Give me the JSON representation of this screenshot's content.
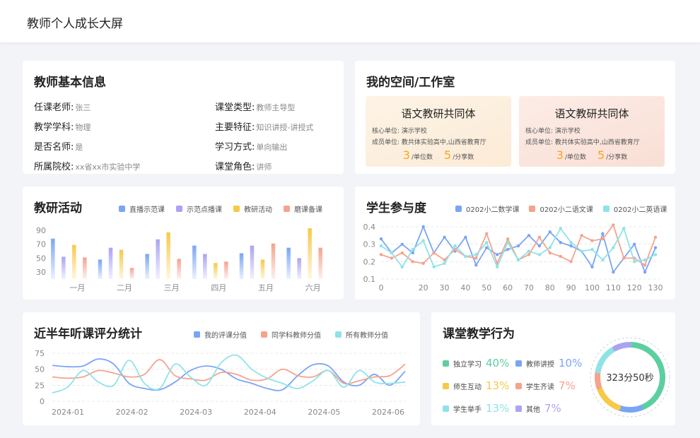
{
  "header": {
    "title": "教师个人成长大屏"
  },
  "teacher_info": {
    "title": "教师基本信息",
    "left": [
      {
        "label": "任课老师:",
        "value": "张三"
      },
      {
        "label": "教学学科:",
        "value": "物理"
      },
      {
        "label": "是否名师:",
        "value": "是"
      },
      {
        "label": "所属院校:",
        "value": "xx省xx市实验中学"
      }
    ],
    "right": [
      {
        "label": "课堂类型:",
        "value": "教师主导型"
      },
      {
        "label": "主要特征:",
        "value": "知识讲授-讲授式"
      },
      {
        "label": "学习方式:",
        "value": "单向输出"
      },
      {
        "label": "课堂角色:",
        "value": "讲师"
      }
    ]
  },
  "studio": {
    "title": "我的空间/工作室",
    "cards": [
      {
        "name": "语文教研共同体",
        "core": "核心单位:  演示学校",
        "members": "成员单位:  教共体实验高中,山西省教育厅",
        "units": "3",
        "units_label": "/单位数",
        "shares": "5",
        "shares_label": "/分享数",
        "bg": "#fdf1e2"
      },
      {
        "name": "语文教研共同体",
        "core": "核心单位:  演示学校",
        "members": "成员单位:  教共体实验高中,山西省教育厅",
        "units": "3",
        "units_label": "/单位数",
        "shares": "5",
        "shares_label": "/分享数",
        "bg": "#fbe6df"
      }
    ]
  },
  "research": {
    "title": "教研活动",
    "legend": [
      {
        "name": "直播示范课",
        "color": "#7aa5f5"
      },
      {
        "name": "示范点播课",
        "color": "#aaa3f3"
      },
      {
        "name": "教研活动",
        "color": "#f7c948"
      },
      {
        "name": "磨课备课",
        "color": "#f5a38d"
      }
    ]
  },
  "participation": {
    "title": "学生参与度",
    "legend": [
      {
        "name": "0202小二数学课",
        "color": "#7aa5f5"
      },
      {
        "name": "0202小二语文课",
        "color": "#f5a38d"
      },
      {
        "name": "0202小二英语课",
        "color": "#8fe3e8"
      }
    ]
  },
  "scores": {
    "title": "近半年听课评分统计",
    "legend": [
      {
        "name": "我的评课分值",
        "color": "#7aa5f5"
      },
      {
        "name": "同学科教师分值",
        "color": "#f5a38d"
      },
      {
        "name": "所有教师分值",
        "color": "#8fe3e8"
      }
    ]
  },
  "behavior": {
    "title": "课堂教学行为",
    "items": [
      {
        "label": "独立学习",
        "pct": "40%",
        "color": "#5ccfa0"
      },
      {
        "label": "教师讲授",
        "pct": "10%",
        "color": "#7aa5f5"
      },
      {
        "label": "师生互动",
        "pct": "13%",
        "color": "#f7c948"
      },
      {
        "label": "学生齐读",
        "pct": "7%",
        "color": "#f5a38d"
      },
      {
        "label": "学生举手",
        "pct": "13%",
        "color": "#8fe3e8"
      },
      {
        "label": "其他",
        "pct": "7%",
        "color": "#aaa3f3"
      }
    ],
    "center_text": "323分50秒"
  },
  "chart_data": [
    {
      "type": "bar",
      "categories": [
        "一月",
        "二月",
        "三月",
        "四月",
        "五月",
        "六月"
      ],
      "ylim": [
        20,
        90
      ],
      "yticks": [
        30,
        50,
        70,
        90
      ],
      "series": [
        {
          "name": "直播示范课",
          "color": "#7aa5f5",
          "values": [
            78,
            48,
            56,
            68,
            57,
            65
          ]
        },
        {
          "name": "示范点播课",
          "color": "#aaa3f3",
          "values": [
            52,
            65,
            77,
            56,
            68,
            50
          ]
        },
        {
          "name": "教研活动",
          "color": "#f7c948",
          "values": [
            69,
            62,
            87,
            43,
            48,
            93
          ]
        },
        {
          "name": "磨课备课",
          "color": "#f5a38d",
          "values": [
            51,
            36,
            49,
            45,
            71,
            65
          ]
        }
      ]
    },
    {
      "type": "line",
      "x": [
        0,
        5,
        10,
        15,
        20,
        25,
        30,
        35,
        40,
        45,
        50,
        55,
        60,
        65,
        70,
        75,
        80,
        85,
        90,
        95,
        100,
        105,
        110,
        115,
        120,
        125,
        130
      ],
      "xticks": [
        0,
        20,
        30,
        40,
        50,
        60,
        70,
        80,
        90,
        100,
        110,
        120,
        130
      ],
      "xlim": [
        0,
        132
      ],
      "ylim": [
        0.08,
        0.42
      ],
      "yticks": [
        0.1,
        0.2,
        0.3,
        0.4
      ],
      "series": [
        {
          "name": "0202小二数学课",
          "color": "#7aa5f5",
          "values": [
            0.33,
            0.25,
            0.3,
            0.25,
            0.4,
            0.25,
            0.34,
            0.26,
            0.34,
            0.18,
            0.28,
            0.24,
            0.27,
            0.29,
            0.35,
            0.29,
            0.37,
            0.31,
            0.29,
            0.26,
            0.17,
            0.36,
            0.14,
            0.22,
            0.3,
            0.14,
            0.28
          ]
        },
        {
          "name": "0202小二语文课",
          "color": "#f5a38d",
          "values": [
            0.24,
            0.22,
            0.25,
            0.2,
            0.19,
            0.25,
            0.21,
            0.27,
            0.23,
            0.22,
            0.36,
            0.19,
            0.33,
            0.21,
            0.24,
            0.34,
            0.25,
            0.23,
            0.2,
            0.35,
            0.32,
            0.33,
            0.41,
            0.22,
            0.22,
            0.18,
            0.34
          ]
        },
        {
          "name": "0202小二英语课",
          "color": "#8fe3e8",
          "values": [
            0.29,
            0.25,
            0.17,
            0.27,
            0.32,
            0.17,
            0.19,
            0.29,
            0.23,
            0.24,
            0.31,
            0.17,
            0.31,
            0.21,
            0.26,
            0.24,
            0.28,
            0.39,
            0.31,
            0.26,
            0.27,
            0.21,
            0.28,
            0.39,
            0.2,
            0.21,
            0.24
          ]
        }
      ]
    },
    {
      "type": "line",
      "smooth": true,
      "x": [
        "2024-01",
        "2024-02",
        "2024-03",
        "2024-04",
        "2024-05",
        "2024-06"
      ],
      "ylim": [
        0,
        75
      ],
      "yticks": [
        0,
        25,
        50,
        75
      ],
      "series": [
        {
          "name": "我的评课分值",
          "color": "#7aa5f5",
          "values": [
            56,
            54,
            55,
            66,
            58,
            28,
            20,
            18,
            30,
            48,
            55,
            50,
            35,
            28,
            20,
            18,
            40,
            57,
            55,
            30,
            25,
            42,
            25,
            47
          ]
        },
        {
          "name": "同学科教师分值",
          "color": "#f5a38d",
          "values": [
            38,
            36,
            38,
            48,
            44,
            38,
            42,
            65,
            40,
            35,
            33,
            45,
            42,
            33,
            35,
            50,
            40,
            38,
            48,
            28,
            32,
            38,
            40,
            58
          ]
        },
        {
          "name": "所有教师分值",
          "color": "#8fe3e8",
          "values": [
            13,
            22,
            48,
            30,
            25,
            64,
            28,
            20,
            58,
            38,
            25,
            60,
            72,
            50,
            36,
            28,
            20,
            32,
            48,
            22,
            48,
            30,
            28,
            30
          ]
        }
      ]
    }
  ]
}
